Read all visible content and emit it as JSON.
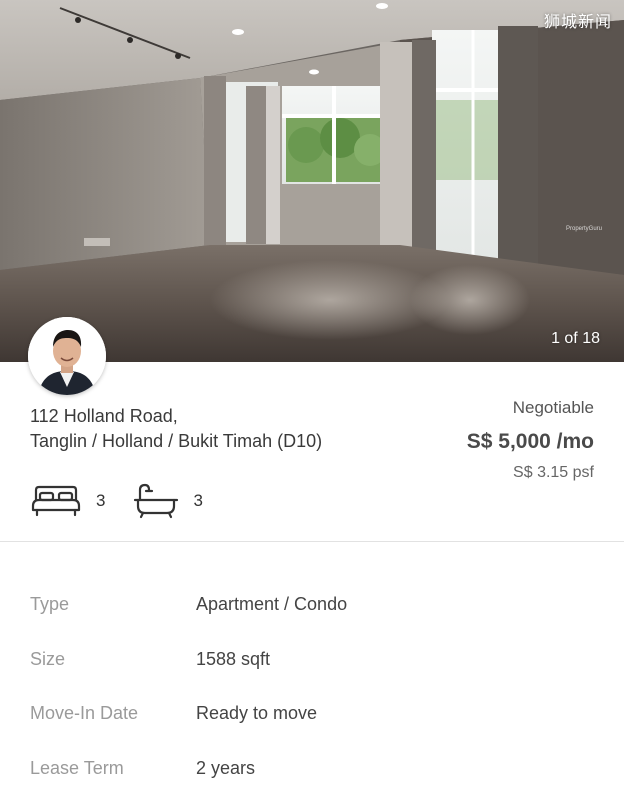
{
  "watermark": "狮城新闻",
  "photo": {
    "counter": "1 of 18",
    "overlay_brand": "PropertyGuru"
  },
  "listing": {
    "address_line1": "112 Holland Road,",
    "address_line2": "Tanglin / Holland / Bukit Timah (D10)",
    "negotiable": "Negotiable",
    "price": "S$ 5,000 /mo",
    "psf": "S$ 3.15 psf",
    "bedrooms": "3",
    "bathrooms": "3"
  },
  "details": [
    {
      "label": "Type",
      "value": "Apartment / Condo"
    },
    {
      "label": "Size",
      "value": "1588 sqft"
    },
    {
      "label": "Move-In Date",
      "value": "Ready to move"
    },
    {
      "label": "Lease Term",
      "value": "2 years"
    }
  ],
  "icons": {
    "bed": "bed-icon",
    "bath": "bathtub-icon",
    "avatar": "agent-avatar"
  }
}
